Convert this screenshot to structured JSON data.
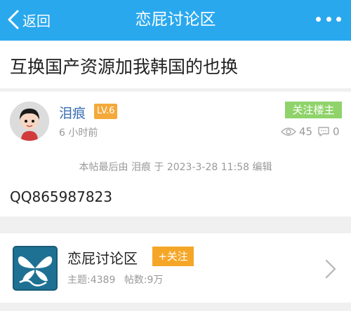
{
  "header": {
    "back_label": "返回",
    "title": "恋屁讨论区",
    "bg_color": "#2aa8ee"
  },
  "post": {
    "title": "互换国产资源加我韩国的也换",
    "author": "泪痕",
    "level": "LV.6",
    "time": "6 小时前",
    "follow_label": "关注楼主",
    "views": "45",
    "comments": "0",
    "edit_note": "本帖最后由 泪痕 于 2023-3-28 11:58 编辑",
    "content": "QQ865987823"
  },
  "forum": {
    "name": "恋屁讨论区",
    "follow_label": "+关注",
    "topics": "主题:4389",
    "posts": "帖数:9万"
  }
}
